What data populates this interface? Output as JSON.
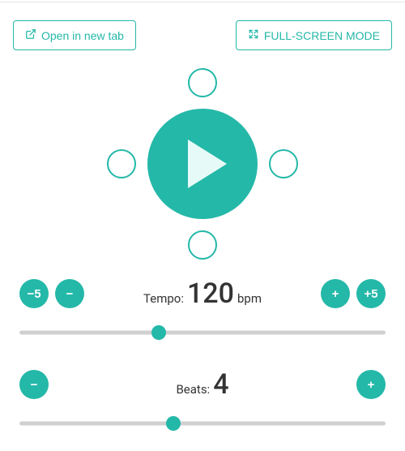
{
  "colors": {
    "accent": "#24b8a8"
  },
  "topbar": {
    "open_label": "Open in new tab",
    "fullscreen_label": "FULL-SCREEN MODE"
  },
  "player": {
    "state": "paused"
  },
  "tempo": {
    "prefix": "Tempo:",
    "value": "120",
    "suffix": "bpm",
    "dec5": "−5",
    "dec1": "−",
    "inc1": "+",
    "inc5": "+5",
    "slider_percent": 38
  },
  "beats": {
    "prefix": "Beats:",
    "value": "4",
    "dec": "−",
    "inc": "+",
    "slider_percent": 42
  }
}
